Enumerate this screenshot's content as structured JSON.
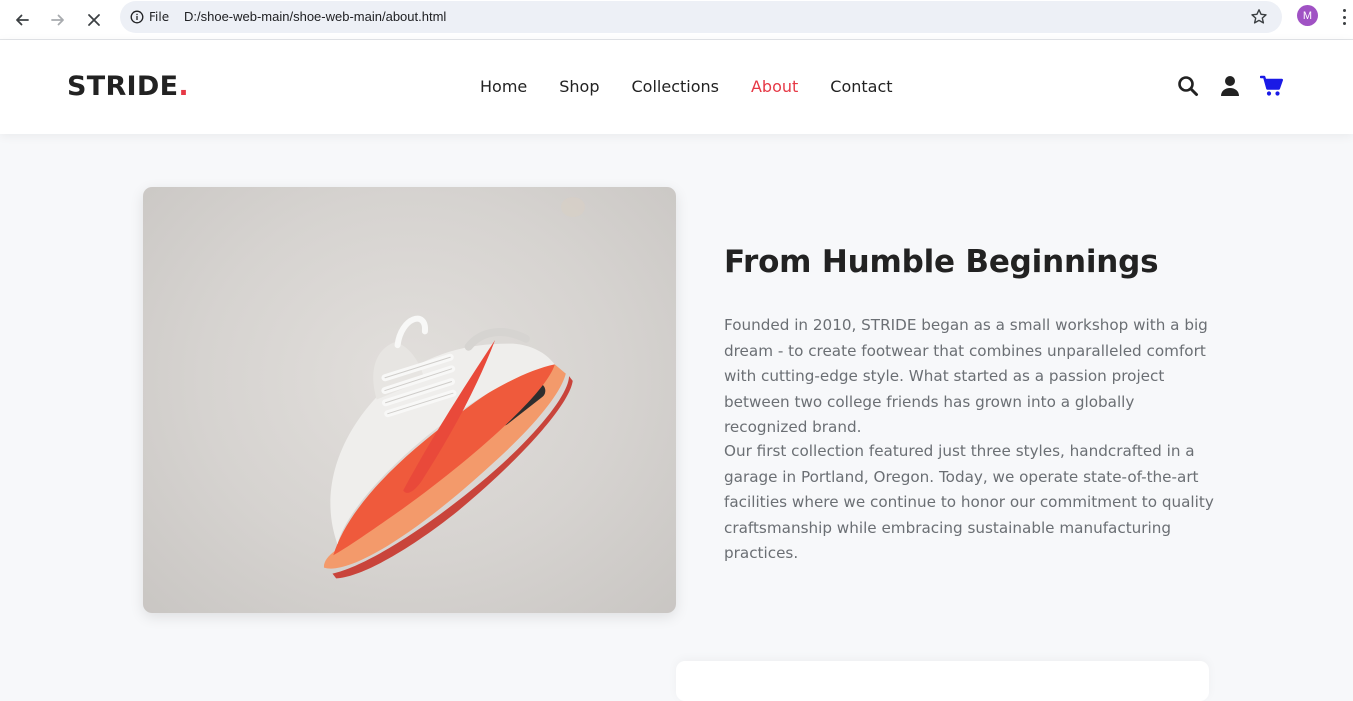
{
  "browser": {
    "site_info_label": "File",
    "url": "D:/shoe-web-main/shoe-web-main/about.html",
    "profile_initial": "M"
  },
  "header": {
    "logo_text": "STRIDE",
    "logo_dot": ".",
    "nav": [
      {
        "label": "Home"
      },
      {
        "label": "Shop"
      },
      {
        "label": "Collections"
      },
      {
        "label": "About",
        "active": true
      },
      {
        "label": "Contact"
      }
    ],
    "icons": [
      "search-icon",
      "user-icon",
      "cart-icon"
    ]
  },
  "story": {
    "title": "From Humble Beginnings",
    "paragraph_1": "Founded in 2010, STRIDE began as a small workshop with a big dream - to create footwear that combines unparalleled comfort with cutting-edge style. What started as a passion project between two college friends has grown into a globally recognized brand.",
    "paragraph_2": "Our first collection featured just three styles, handcrafted in a garage in Portland, Oregon. Today, we operate state-of-the-art facilities where we continue to honor our commitment to quality craftsmanship while embracing sustainable manufacturing practices."
  },
  "colors": {
    "accent": "#e63946",
    "cart": "#1a1ae6",
    "text_dark": "#222222",
    "text_muted": "#6b6f74",
    "page_bg": "#f7f8fa"
  }
}
